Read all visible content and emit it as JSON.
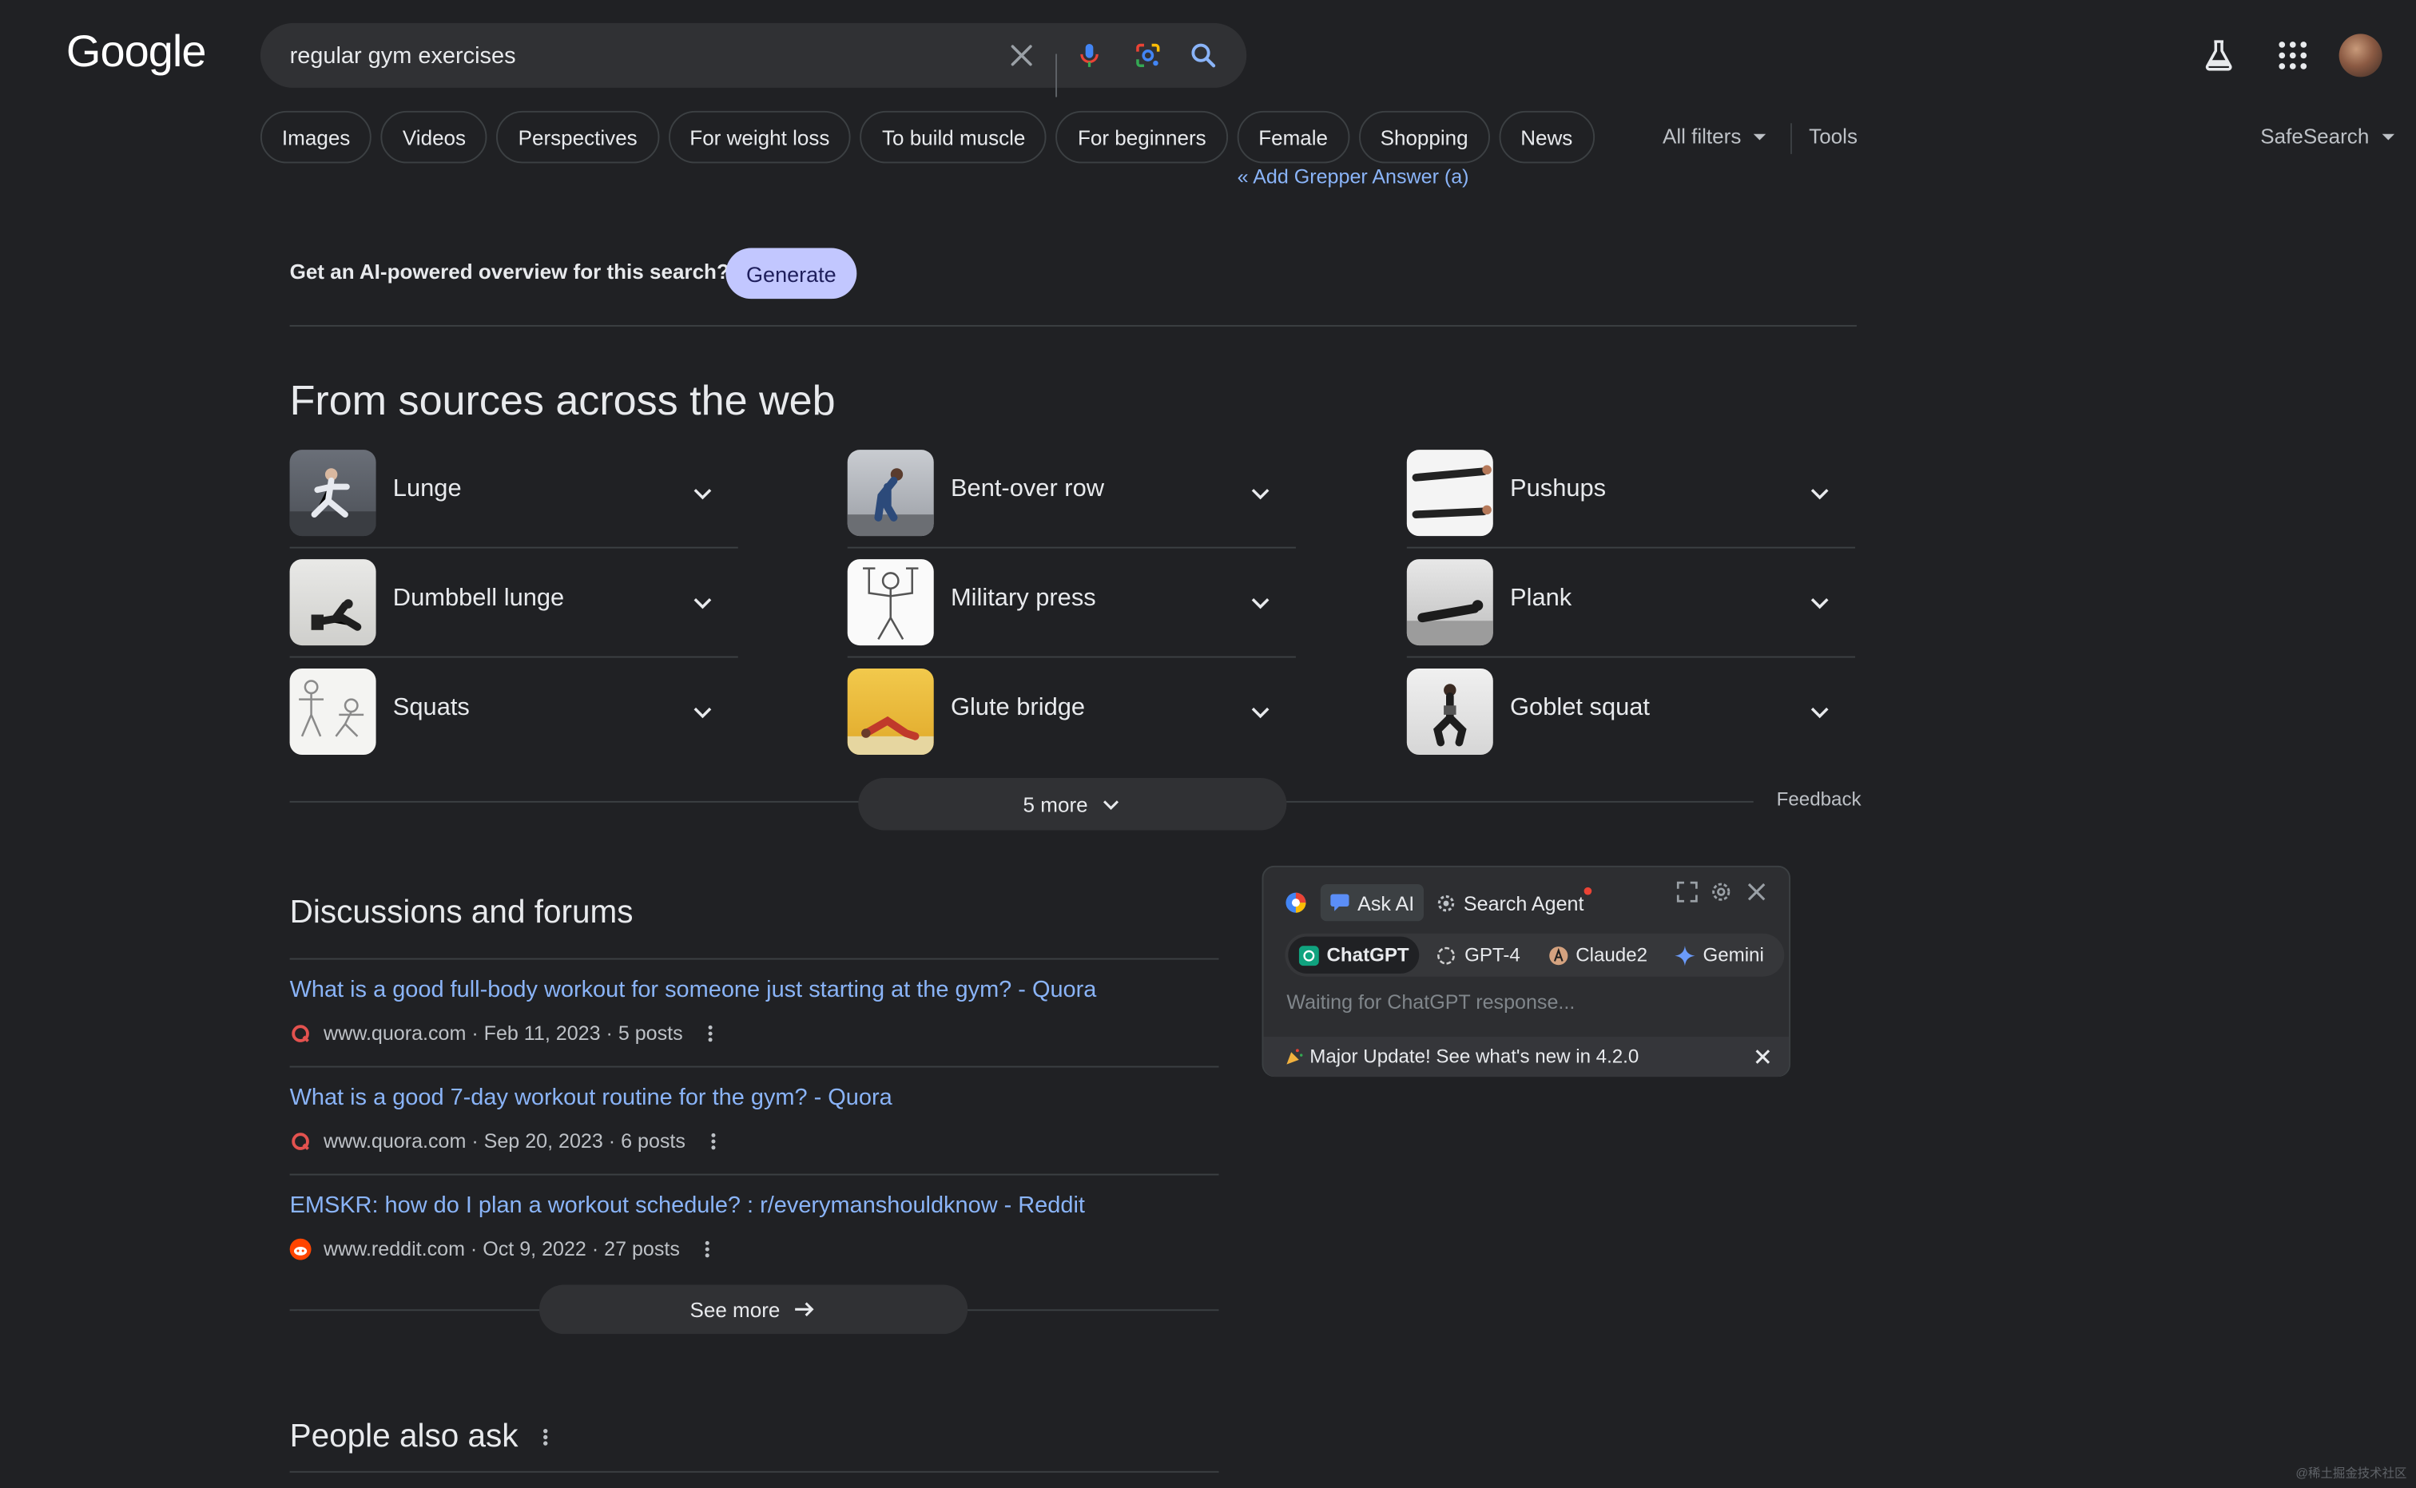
{
  "header": {
    "logo_text": "Google",
    "search_value": "regular gym exercises",
    "icons": [
      "close-icon",
      "mic-icon",
      "lens-icon",
      "search-icon",
      "labs-icon",
      "apps-icon",
      "avatar"
    ]
  },
  "chips": [
    "Images",
    "Videos",
    "Perspectives",
    "For weight loss",
    "To build muscle",
    "For beginners",
    "Female",
    "Shopping",
    "News"
  ],
  "tools": {
    "all_filters": "All filters",
    "tools": "Tools",
    "safesearch": "SafeSearch"
  },
  "grepper_link": "« Add Grepper Answer (a)",
  "ai_overview": {
    "question": "Get an AI-powered overview for this search?",
    "button": "Generate"
  },
  "from_sources": {
    "title": "From sources across the web",
    "items": [
      {
        "label": "Lunge",
        "thumb": "lunge"
      },
      {
        "label": "Bent-over row",
        "thumb": "row"
      },
      {
        "label": "Pushups",
        "thumb": "pushup"
      },
      {
        "label": "Dumbbell lunge",
        "thumb": "dlunge"
      },
      {
        "label": "Military press",
        "thumb": "press"
      },
      {
        "label": "Plank",
        "thumb": "plank"
      },
      {
        "label": "Squats",
        "thumb": "squat"
      },
      {
        "label": "Glute bridge",
        "thumb": "bridge"
      },
      {
        "label": "Goblet squat",
        "thumb": "goblet"
      }
    ],
    "more_label": "5 more",
    "feedback": "Feedback"
  },
  "discussions": {
    "title": "Discussions and forums",
    "items": [
      {
        "title": "What is a good full-body workout for someone just starting at the gym? - Quora",
        "meta": "www.quora.com · Feb 11, 2023 · 5 posts",
        "source": "quora"
      },
      {
        "title": "What is a good 7-day workout routine for the gym? - Quora",
        "meta": "www.quora.com · Sep 20, 2023 · 6 posts",
        "source": "quora"
      },
      {
        "title": "EMSKR: how do I plan a workout schedule? : r/everymanshouldknow - Reddit",
        "meta": "www.reddit.com · Oct 9, 2022 · 27 posts",
        "source": "reddit"
      }
    ],
    "see_more": "See more"
  },
  "people_also_ask": {
    "title": "People also ask"
  },
  "ai_panel": {
    "tabs": [
      "Ask AI",
      "Search Agent"
    ],
    "models": [
      "ChatGPT",
      "GPT-4",
      "Claude2",
      "Gemini"
    ],
    "placeholder": "Waiting for ChatGPT response...",
    "update_text": "Major Update! See what's new in 4.2.0"
  },
  "watermark": "@稀土掘金技术社区",
  "colors": {
    "background": "#202124",
    "link": "#8ab4f8",
    "generate_button": "#c2c7ff",
    "surface": "#303134"
  }
}
